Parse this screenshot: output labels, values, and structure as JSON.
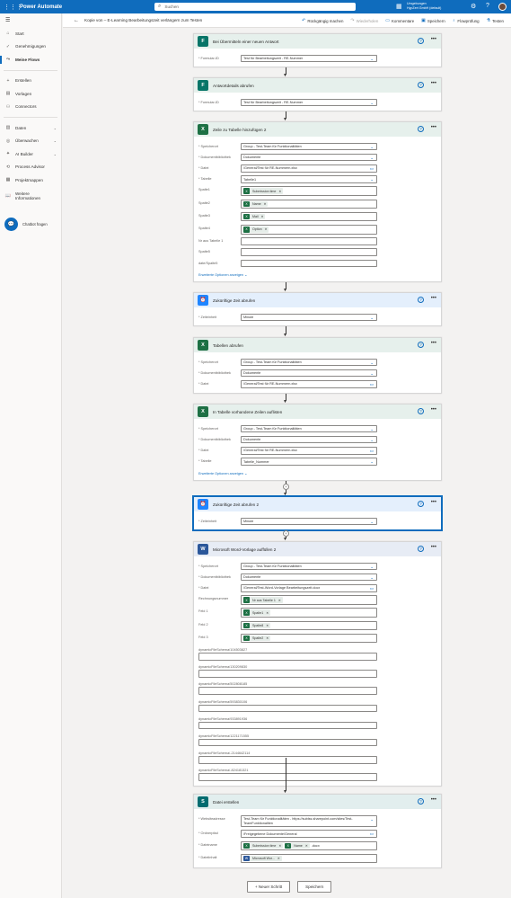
{
  "app": {
    "name": "Power Automate",
    "search_placeholder": "Suchen",
    "environment_label": "Umgebungen",
    "environment_name": "HypZert GmbH (default)"
  },
  "nav": {
    "items": [
      {
        "label": "Start",
        "icon": "home-icon"
      },
      {
        "label": "Genehmigungen",
        "icon": "approvals-icon"
      },
      {
        "label": "Meine Flows",
        "icon": "flows-icon",
        "active": true
      },
      {
        "label": "Erstellen",
        "icon": "plus-icon"
      },
      {
        "label": "Vorlagen",
        "icon": "templates-icon"
      },
      {
        "label": "Connectors",
        "icon": "connectors-icon"
      },
      {
        "label": "Daten",
        "icon": "data-icon",
        "chevron": true
      },
      {
        "label": "Überwachen",
        "icon": "monitor-icon",
        "chevron": true
      },
      {
        "label": "AI Builder",
        "icon": "ai-icon",
        "chevron": true
      },
      {
        "label": "Process Advisor",
        "icon": "process-icon"
      },
      {
        "label": "Projektmappen",
        "icon": "solutions-icon"
      },
      {
        "label": "Weitere Informationen",
        "icon": "learn-icon"
      }
    ],
    "chatbot_label": "Chatbot fragen"
  },
  "cmdbar": {
    "flow_title": "Kopie von – E-Learning Bearbeitungszeit verlängern zum Testen",
    "undo": "Rückgängig machen",
    "redo": "Wiederholen",
    "comments": "Kommentare",
    "save": "Speichern",
    "flow_checker": "Flowprüfung",
    "test": "Testen"
  },
  "cards": [
    {
      "title": "Bei Übermitteln einer neuen Antwort",
      "kind": "forms",
      "fields": [
        {
          "label": "* Formular-ID",
          "value": "Test für Bearbeitungszeit - RE-Nummer",
          "dd": true
        }
      ]
    },
    {
      "title": "Antwortdetails abrufen",
      "kind": "forms",
      "fields": [
        {
          "label": "* Formular-ID",
          "value": "Test für Bearbeitungszeit - RE-Nummer",
          "dd": true
        }
      ]
    },
    {
      "title": "Zeile zu Tabelle hinzufügen 2",
      "kind": "excel",
      "fields": [
        {
          "label": "* Speicherort",
          "value": "Group - Test-Team für Funktionalitäten",
          "dd": true
        },
        {
          "label": "* Dokumentbibliothek",
          "value": "Dokumente",
          "dd": true
        },
        {
          "label": "* Datei",
          "value": "/General/Test für RE-Nummern.xlsx",
          "fp": true
        },
        {
          "label": "* Tabelle",
          "value": "Tabelle1",
          "dd": true
        },
        {
          "label": "Spalte1",
          "tokens": [
            "Submission time"
          ]
        },
        {
          "label": "Spalte2",
          "tokens": [
            "Name"
          ]
        },
        {
          "label": "Spalte3",
          "tokens": [
            "Mail"
          ]
        },
        {
          "label": "Spalte4",
          "tokens": [
            "Option"
          ]
        },
        {
          "label": "Nr aus Tabelle 1",
          "value": ""
        },
        {
          "label": "Spalte5",
          "value": ""
        },
        {
          "label": "date/Spalte5",
          "value": ""
        }
      ],
      "advanced": "Erweiterte Optionen anzeigen"
    },
    {
      "title": "Zukünftige Zeit abrufen",
      "kind": "sched",
      "fields": [
        {
          "label": "* Zeiteinheit",
          "value": "Minute",
          "dd": true
        }
      ]
    },
    {
      "title": "Tabellen abrufen",
      "kind": "excel",
      "fields": [
        {
          "label": "* Speicherort",
          "value": "Group - Test-Team für Funktionalitäten",
          "dd": true
        },
        {
          "label": "* Dokumentbibliothek",
          "value": "Dokumente",
          "dd": true
        },
        {
          "label": "* Datei",
          "value": "/General/Test für RE-Nummern.xlsx",
          "fp": true
        }
      ]
    },
    {
      "title": "In Tabelle vorhandene Zeilen auflisten",
      "kind": "excel",
      "fields": [
        {
          "label": "* Speicherort",
          "value": "Group - Test-Team für Funktionalitäten",
          "dd": true
        },
        {
          "label": "* Dokumentbibliothek",
          "value": "Dokumente",
          "dd": true
        },
        {
          "label": "* Datei",
          "value": "/General/Test für RE-Nummern.xlsx",
          "fp": true
        },
        {
          "label": "* Tabelle",
          "value": "Tabelle_Nummer",
          "dd": true
        }
      ],
      "advanced": "Erweiterte Optionen anzeigen"
    },
    {
      "title": "Zukünftige Zeit abrufen 2",
      "kind": "sched",
      "selected": true,
      "fields": [
        {
          "label": "* Zeiteinheit",
          "value": "Minute",
          "dd": true
        }
      ]
    },
    {
      "title": "Microsoft Word-Vorlage auffüllen 2",
      "kind": "word",
      "fields": [
        {
          "label": "* Speicherort",
          "value": "Group - Test-Team für Funktionalitäten",
          "dd": true
        },
        {
          "label": "* Dokumentbibliothek",
          "value": "Dokumente",
          "dd": true
        },
        {
          "label": "* Datei",
          "value": "/General/Test-Word-Vorlage Bearbeitungszeit.docx",
          "fp": true
        },
        {
          "label": "Rechnungsnummer",
          "tokens": [
            "Nr aus Tabelle 1"
          ]
        },
        {
          "label": "Feld 1",
          "tokens": [
            "Spalte1"
          ]
        },
        {
          "label": "Feld 2",
          "tokens": [
            "Spalte8"
          ]
        },
        {
          "label": "Feld 3",
          "tokens": [
            "Spalte2"
          ]
        },
        {
          "label": "dynamicFileSchema/104503827",
          "value": "",
          "stack": true
        },
        {
          "label": "dynamicFileSchema/130209830",
          "value": "",
          "stack": true
        },
        {
          "label": "dynamicFileSchema/502808185",
          "value": "",
          "stack": true
        },
        {
          "label": "dynamicFileSchema/593830106",
          "value": "",
          "stack": true
        },
        {
          "label": "dynamicFileSchema/933891936",
          "value": "",
          "stack": true
        },
        {
          "label": "dynamicFileSchema/1221171555",
          "value": "",
          "stack": true
        },
        {
          "label": "dynamicFileSchema/-2144642114",
          "value": "",
          "stack": true
        },
        {
          "label": "dynamicFileSchema/-824181321",
          "value": "",
          "stack": true
        }
      ]
    },
    {
      "title": "Datei erstellen",
      "kind": "sp",
      "fields": [
        {
          "label": "* Websiteadresse",
          "value": "Test-Team für Funktionalitäten - https://sublss.sharepoint.com/sites/Test-TeamFunktionaliten",
          "dd": true,
          "tall": true
        },
        {
          "label": "* Ordnerpfad",
          "value": "/Freigegebene Dokumente/General",
          "fp": true
        },
        {
          "label": "* Dateiname",
          "tokens": [
            "Submission time",
            "Name"
          ],
          "suffix": ".docx"
        },
        {
          "label": "* Dateiinhalt",
          "wtokens": [
            "Microsoft Wor..."
          ]
        }
      ]
    }
  ],
  "bottom": {
    "new_step": "+ Neuer Schritt",
    "save": "Speichern"
  }
}
